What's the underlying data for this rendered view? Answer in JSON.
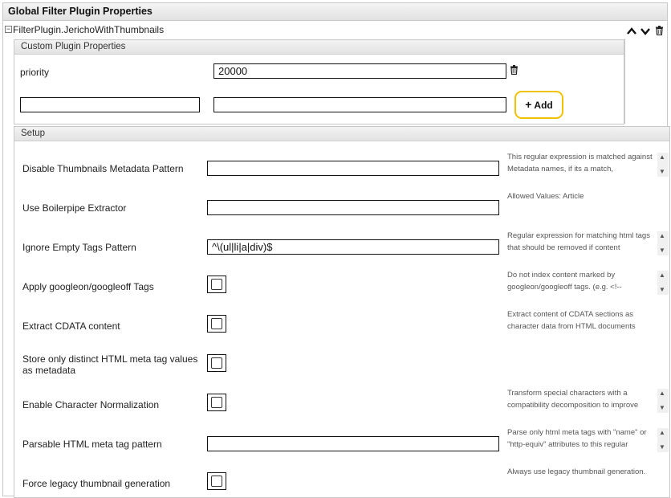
{
  "panel": {
    "title": "Global Filter Plugin Properties"
  },
  "plugin": {
    "name": "FilterPlugin.JerichoWithThumbnails",
    "collapse_symbol": "−",
    "icons": [
      "chevron-up-icon",
      "chevron-down-icon",
      "trash-icon"
    ]
  },
  "custom": {
    "header": "Custom Plugin Properties",
    "priority_label": "priority",
    "priority_value": "20000",
    "new_key_value": "",
    "new_value_value": "",
    "add_label": "Add",
    "add_icon": "+"
  },
  "setup": {
    "header": "Setup",
    "rows": [
      {
        "label": "Disable Thumbnails Metadata Pattern",
        "type": "text",
        "value": "",
        "desc": "This regular expression is matched against Metadata names, if its a match,",
        "scroll": true
      },
      {
        "label": "Use Boilerpipe Extractor",
        "type": "text",
        "value": "",
        "desc": "Allowed Values: Article",
        "scroll": false
      },
      {
        "label": "Ignore Empty Tags Pattern",
        "type": "text",
        "value": "^\\(ul|li|a|div)$",
        "desc": "Regular expression for matching html tags that should be removed if content",
        "scroll": true
      },
      {
        "label": "Apply googleon/googleoff Tags",
        "type": "checkbox",
        "value": false,
        "desc": "Do not index content marked by googleon/googleoff tags. (e.g. <!--",
        "scroll": true
      },
      {
        "label": "Extract CDATA content",
        "type": "checkbox",
        "value": false,
        "desc": "Extract content of CDATA sections as character data from HTML documents",
        "scroll": false
      },
      {
        "label": "Store only distinct HTML meta tag values as metadata",
        "type": "checkbox",
        "value": false,
        "desc": "",
        "scroll": false
      },
      {
        "label": "Enable Character Normalization",
        "type": "checkbox",
        "value": false,
        "desc": "Transform special characters with a compatibility decomposition to improve",
        "scroll": true
      },
      {
        "label": "Parsable HTML meta tag pattern",
        "type": "text",
        "value": "",
        "desc": "Parse only html meta tags with \"name\" or \"http-equiv\" attributes to this regular",
        "scroll": true
      },
      {
        "label": "Force legacy thumbnail generation",
        "type": "checkbox",
        "value": false,
        "desc": "Always use legacy thumbnail generation.",
        "scroll": false
      }
    ]
  }
}
